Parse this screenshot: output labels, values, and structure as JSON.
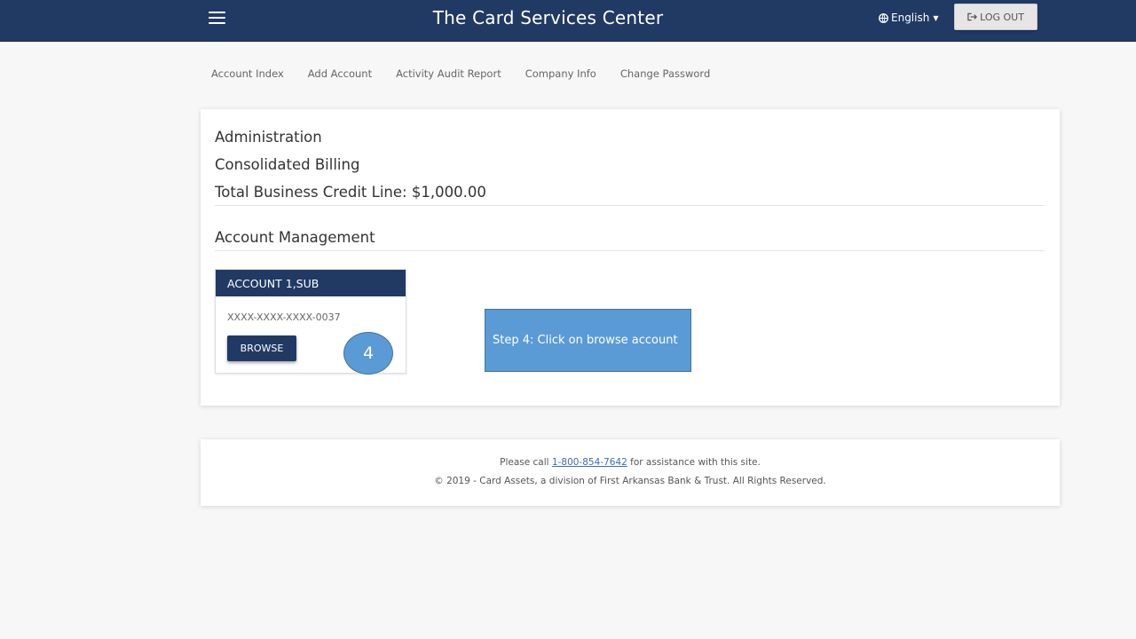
{
  "header": {
    "title": "The Card Services Center",
    "language": "English",
    "logout_label": "LOG OUT"
  },
  "subnav": {
    "items": [
      "Account Index",
      "Add Account",
      "Activity Audit Report",
      "Company Info",
      "Change Password"
    ]
  },
  "main": {
    "admin_heading": "Administration",
    "billing_heading": "Consolidated Billing",
    "credit_line": "Total Business Credit Line: $1,000.00",
    "mgmt_heading": "Account Management",
    "account": {
      "name": "ACCOUNT 1,SUB",
      "number": "XXXX-XXXX-XXXX-0037",
      "browse_label": "BROWSE"
    }
  },
  "overlay": {
    "step_number": "4",
    "callout_text": "Step 4: Click on browse account"
  },
  "footer": {
    "call_prefix": "Please call",
    "phone": "1-800-854-7642",
    "call_suffix": "for assistance with this site.",
    "copyright": "© 2019 - Card Assets, a division of First Arkansas Bank & Trust. All Rights Reserved."
  },
  "colors": {
    "navy": "#213a63",
    "callout_blue": "#5b9bd5",
    "page_bg": "#f7f7f7"
  },
  "icons": [
    "menu-icon",
    "globe-icon",
    "caret-down-icon",
    "sign-out-icon"
  ]
}
